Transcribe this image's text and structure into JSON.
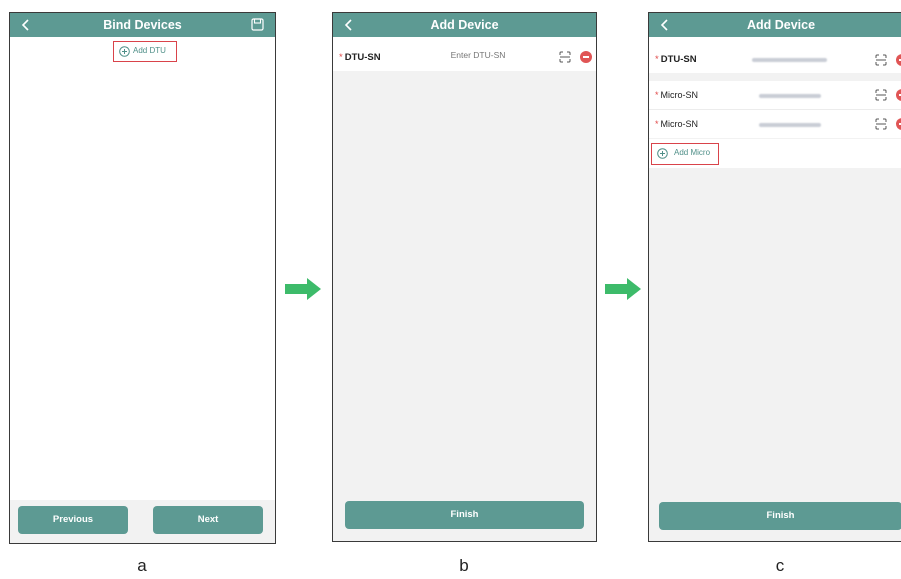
{
  "panel_a": {
    "title": "Bind Devices",
    "add_dtu_label": "Add DTU",
    "previous_label": "Previous",
    "next_label": "Next"
  },
  "panel_b": {
    "title": "Add Device",
    "dtu_label": "DTU-SN",
    "dtu_placeholder": "Enter DTU-SN",
    "finish_label": "Finish"
  },
  "panel_c": {
    "title": "Add Device",
    "dtu_label": "DTU-SN",
    "micro_label_1": "Micro-SN",
    "micro_label_2": "Micro-SN",
    "add_micro_label": "Add Micro",
    "finish_label": "Finish"
  },
  "required_marker": "*",
  "captions": [
    "a",
    "b",
    "c"
  ],
  "colors": {
    "header": "#5d9a93",
    "accent_text": "#4f8f88",
    "highlight_box": "#d9434a",
    "arrow": "#3dbb6a",
    "delete": "#e05555"
  },
  "icons": [
    "chevron-left-icon",
    "save-icon",
    "plus-circle-icon",
    "scan-icon",
    "minus-circle-icon",
    "right-arrow-icon"
  ]
}
